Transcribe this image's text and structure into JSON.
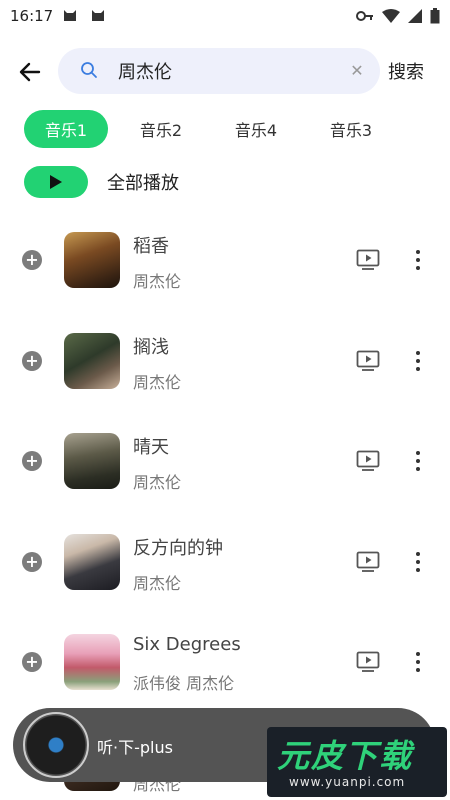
{
  "status_bar": {
    "time": "16:17"
  },
  "search": {
    "value": "周杰伦",
    "button_label": "搜索"
  },
  "tabs": [
    {
      "label": "音乐1",
      "active": true
    },
    {
      "label": "音乐2",
      "active": false
    },
    {
      "label": "音乐4",
      "active": false
    },
    {
      "label": "音乐3",
      "active": false
    }
  ],
  "play_all": {
    "label": "全部播放"
  },
  "songs": [
    {
      "title": "稻香",
      "artist": "周杰伦"
    },
    {
      "title": "搁浅",
      "artist": "周杰伦"
    },
    {
      "title": "晴天",
      "artist": "周杰伦"
    },
    {
      "title": "反方向的钟",
      "artist": "周杰伦"
    },
    {
      "title": "Six Degrees",
      "artist": "派伟俊 周杰伦"
    },
    {
      "title": "",
      "artist": "周杰伦"
    }
  ],
  "player": {
    "title": "听·下-plus"
  },
  "watermark": {
    "main": "元皮下载",
    "url": "www.yuanpi.com"
  },
  "colors": {
    "accent": "#22d273",
    "player_bg": "#545454"
  }
}
